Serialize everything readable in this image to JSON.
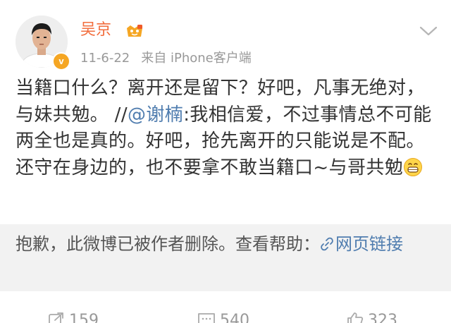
{
  "user": {
    "name": "吴京",
    "verified_mark": "v",
    "badge_icon": "vip-badge-icon"
  },
  "post": {
    "date": "11-6-22",
    "source": "来自 iPhone客户端",
    "text_main": "当籍口什么？离开还是留下？好吧，凡事无绝对，与妹共勉。 //",
    "mention": "@谢楠",
    "text_quote": ":我相信爱，不过事情总不可能两全也是真的。好吧，抢先离开的只能说是不配。还守在身边的，也不要拿不敢当籍口~与哥共勉",
    "emoji_icon": "grin-emoji-icon"
  },
  "retweet": {
    "deleted_notice": "抱歉，此微博已被作者删除。查看帮助：",
    "help_link": "网页链接"
  },
  "actions": {
    "repost_count": "159",
    "comment_count": "540",
    "like_count": "323"
  },
  "colors": {
    "username": "#f26d3d",
    "link": "#507daf",
    "meta": "#999999",
    "deleted_bg": "#f2f2f2"
  }
}
